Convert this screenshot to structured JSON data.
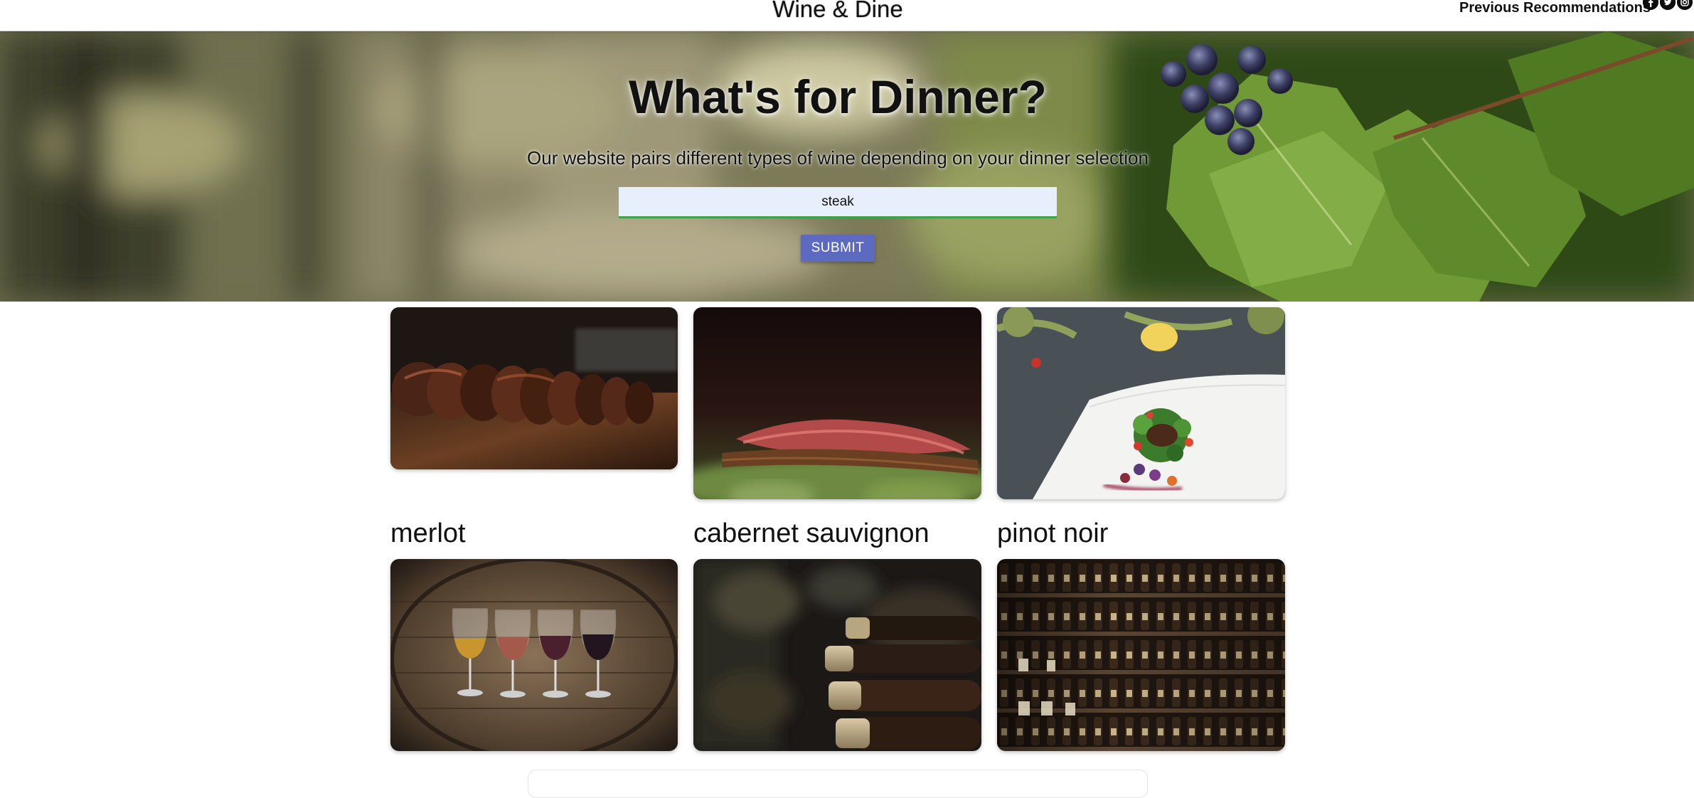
{
  "nav": {
    "brand": "Wine & Dine",
    "previous_link": "Previous Recommendations",
    "social_icons": [
      "facebook-icon",
      "twitter-icon",
      "instagram-icon"
    ]
  },
  "hero": {
    "title": "What's for Dinner?",
    "subtitle": "Our website pairs different types of wine depending on your dinner selection",
    "search_value": "steak",
    "submit_label": "SUBMIT"
  },
  "wines": [
    {
      "name": "merlot"
    },
    {
      "name": "cabernet sauvignon"
    },
    {
      "name": "pinot noir"
    }
  ],
  "colors": {
    "submit_bg": "#5c6bc0",
    "input_bg": "#e8effc",
    "input_underline": "#43a047"
  }
}
